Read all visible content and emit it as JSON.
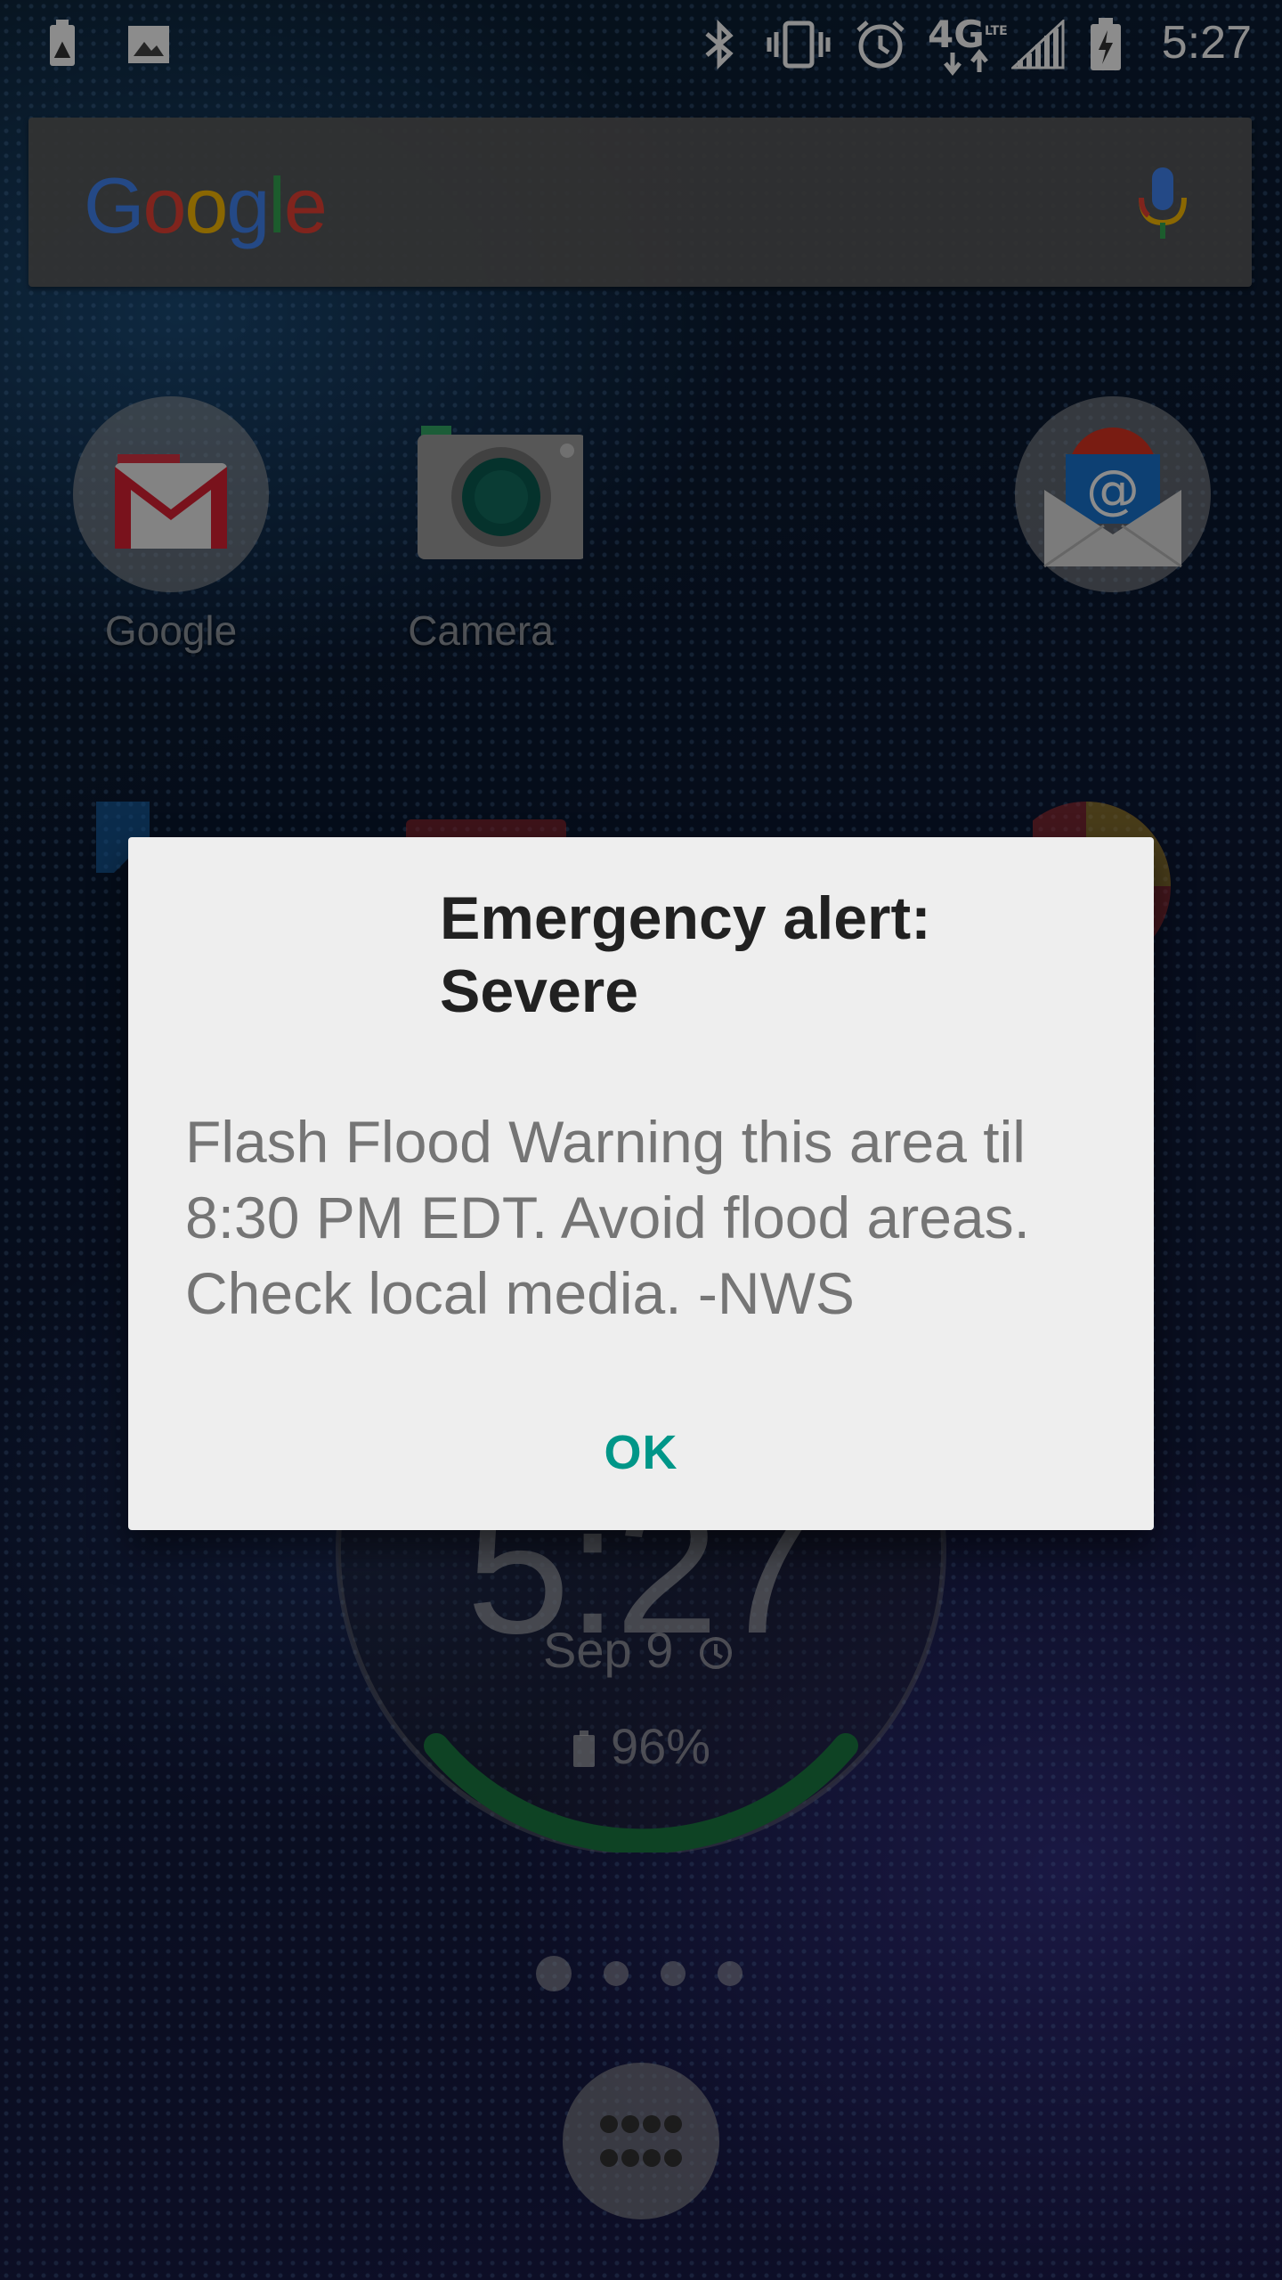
{
  "status_bar": {
    "time": "5:27",
    "network": "4G LTE"
  },
  "search": {
    "logo": "Google"
  },
  "apps": [
    {
      "label": "Google"
    },
    {
      "label": "Camera"
    }
  ],
  "clock_widget": {
    "time": "5:27",
    "date": "Sep 9",
    "battery": "96%"
  },
  "dialog": {
    "title": "Emergency alert: Severe",
    "message": "Flash Flood Warning this area til 8:30 PM EDT. Avoid flood areas. Check local media. -NWS",
    "ok_label": "OK"
  },
  "colors": {
    "accent": "#009688",
    "dialog_bg": "#eeeeee",
    "title": "#212121",
    "message": "#757575"
  }
}
